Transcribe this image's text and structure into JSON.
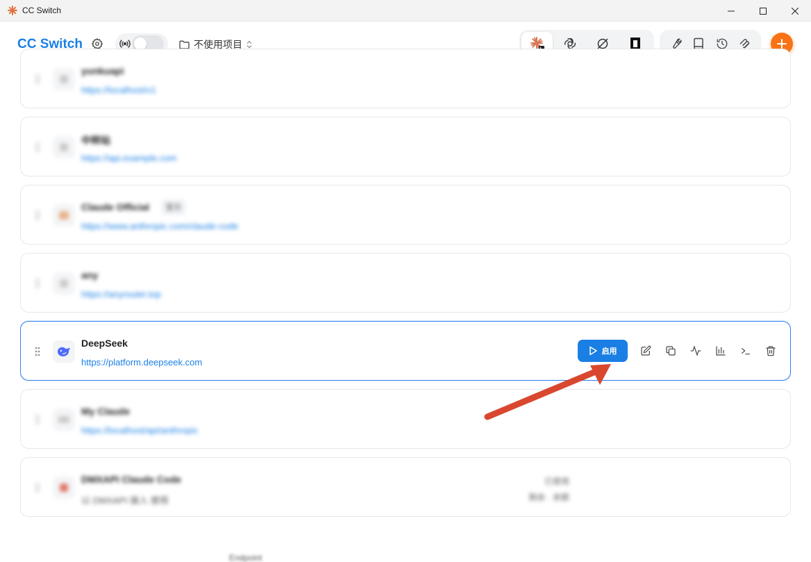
{
  "window": {
    "title": "CC Switch",
    "controls": [
      "minimize",
      "maximize",
      "close"
    ]
  },
  "header": {
    "brand": "CC Switch",
    "project_selector": "不使用项目",
    "proxy_enabled": false,
    "apps": [
      {
        "name": "claude-code",
        "active": true
      },
      {
        "name": "openai",
        "active": false
      },
      {
        "name": "gemini",
        "active": false
      },
      {
        "name": "terminal-app",
        "active": false
      }
    ],
    "tools": [
      "wrench-icon",
      "book-icon",
      "history-icon",
      "mcp-icon"
    ]
  },
  "providers": [
    {
      "name": "yunkuapi",
      "url": "https://localhost/v1",
      "blurred": true
    },
    {
      "name": "中转站",
      "url": "https://api.example.com",
      "blurred": true
    },
    {
      "name": "Claude Official",
      "badge": "官方",
      "url": "https://www.anthropic.com/claude-code",
      "blurred": true
    },
    {
      "name": "any",
      "url": "https://anyrouter.top",
      "blurred": true
    },
    {
      "name": "DeepSeek",
      "url": "https://platform.deepseek.com",
      "blurred": false,
      "active": true
    },
    {
      "name": "My Claude",
      "url": "https://localhost/api/anthropic",
      "blurred": true
    },
    {
      "name": "DMXAPI Claude Code",
      "url": "以 DMXAPI 接入 使用",
      "meta1": "已使用",
      "meta2": "剩余 · 余额",
      "blurred": true
    }
  ],
  "active_actions": {
    "enable_label": "启用",
    "icons": [
      "edit-icon",
      "duplicate-icon",
      "speed-test-icon",
      "usage-chart-icon",
      "terminal-icon",
      "delete-icon"
    ]
  },
  "colors": {
    "accent": "#1a7fe4",
    "add_button": "#f97316",
    "annotation_arrow": "#d9472f"
  },
  "footer_peek": "Endpoint"
}
